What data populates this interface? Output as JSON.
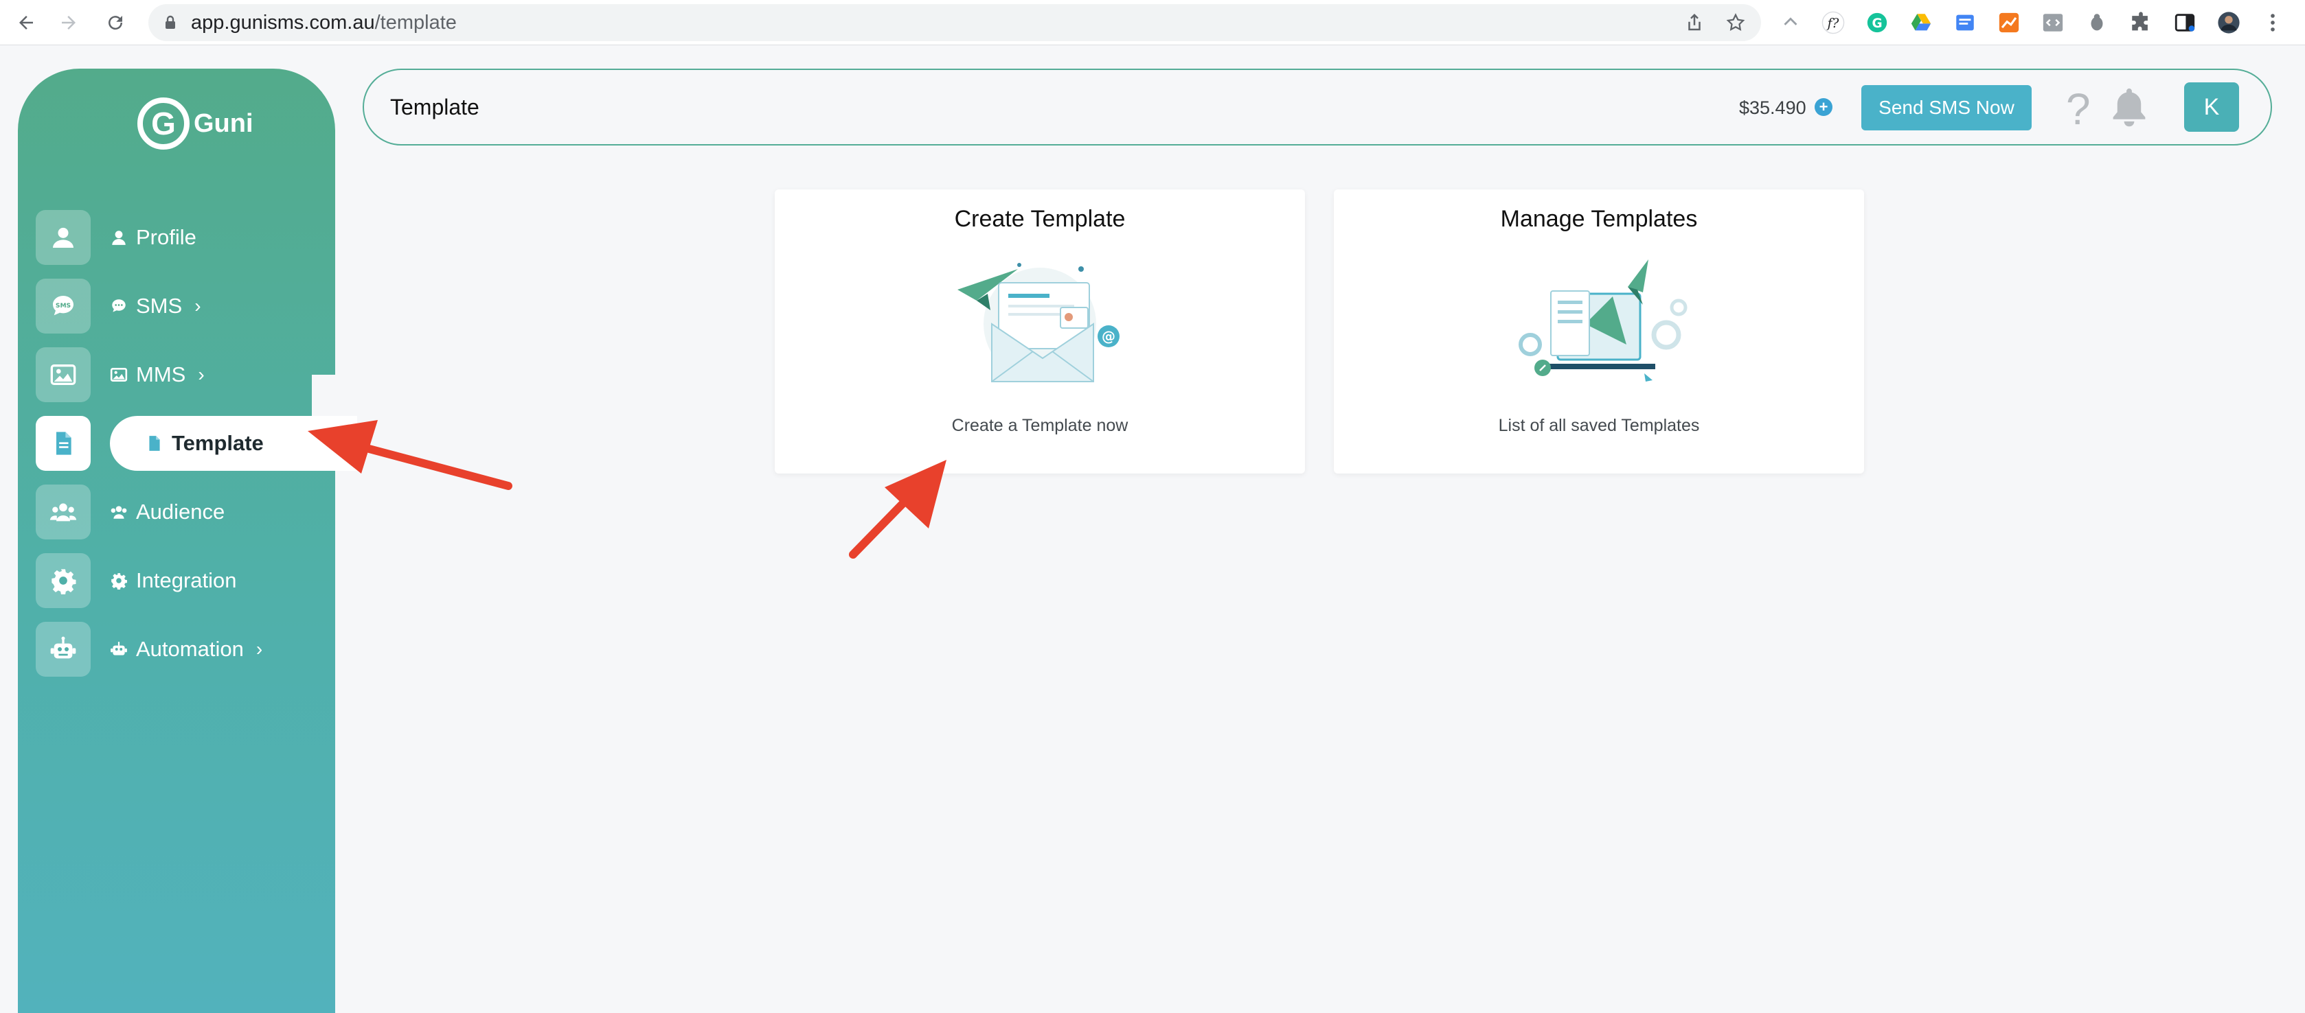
{
  "browser": {
    "url_host": "app.gunisms.com.au",
    "url_path": "/template"
  },
  "sidebar": {
    "logo_letter": "G",
    "logo_text": "Guni",
    "items": [
      {
        "label": "Profile",
        "icon": "user-icon",
        "has_chevron": false
      },
      {
        "label": "SMS",
        "icon": "sms-icon",
        "has_chevron": true
      },
      {
        "label": "MMS",
        "icon": "image-icon",
        "has_chevron": true
      },
      {
        "label": "Template",
        "icon": "file-icon",
        "has_chevron": false,
        "active": true
      },
      {
        "label": "Audience",
        "icon": "users-icon",
        "has_chevron": false
      },
      {
        "label": "Integration",
        "icon": "gear-icon",
        "has_chevron": false
      },
      {
        "label": "Automation",
        "icon": "robot-icon",
        "has_chevron": true
      }
    ],
    "chevron": "›"
  },
  "header": {
    "title": "Template",
    "balance": "$35.490",
    "send_button": "Send SMS Now",
    "help_symbol": "?",
    "avatar_letter": "K"
  },
  "cards": [
    {
      "title": "Create Template",
      "subtitle": "Create a Template now"
    },
    {
      "title": "Manage Templates",
      "subtitle": "List of all saved Templates"
    }
  ],
  "colors": {
    "sidebar_top": "#53ab8b",
    "sidebar_bottom": "#52b2bc",
    "accent": "#4ab2c9",
    "annotation_arrow": "#e8412c"
  }
}
